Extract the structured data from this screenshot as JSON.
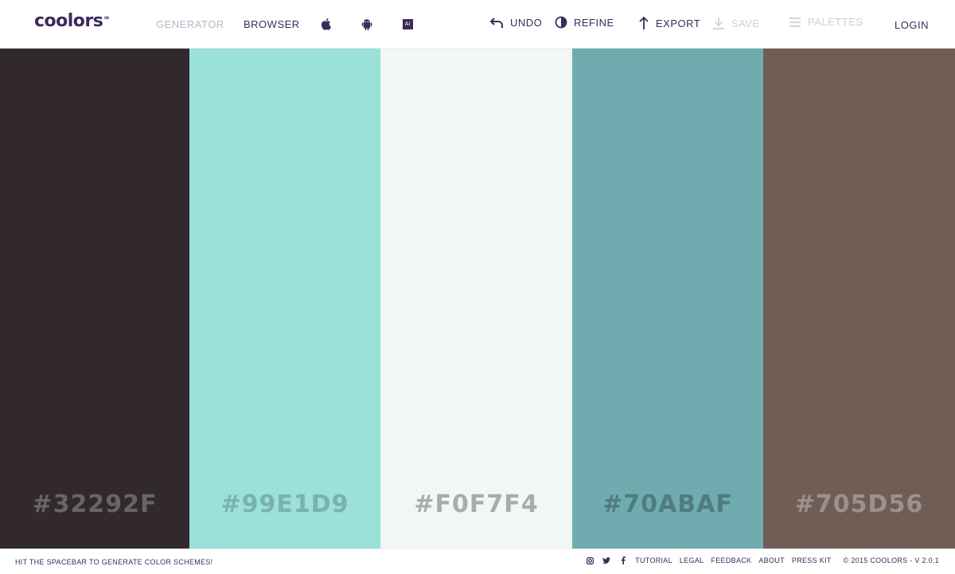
{
  "header": {
    "logo": "coolors",
    "logo_mark": "∞",
    "nav": {
      "generator": "GENERATOR",
      "browser": "BROWSER"
    },
    "platform_icons": [
      "apple-icon",
      "android-icon",
      "adobe-illustrator-icon"
    ],
    "ai_badge": "Ai",
    "actions": {
      "undo": "UNDO",
      "refine": "REFINE",
      "export": "EXPORT",
      "save": "SAVE",
      "palettes": "PALETTES",
      "login": "LOGIN"
    }
  },
  "palette": [
    {
      "hex": "#32292F",
      "color": "#32292F",
      "label_color": "#6a6368"
    },
    {
      "hex": "#99E1D9",
      "color": "#99E1D9",
      "label_color": "#79b3ad"
    },
    {
      "hex": "#F0F7F4",
      "color": "#F0F7F4",
      "label_color": "#a8adaa"
    },
    {
      "hex": "#70ABAF",
      "color": "#70ABAF",
      "label_color": "#4f7c80"
    },
    {
      "hex": "#705D56",
      "color": "#705D56",
      "label_color": "#9e908a"
    }
  ],
  "footer": {
    "hint": "HIT THE SPACEBAR TO GENERATE COLOR SCHEMES!",
    "social_icons": [
      "instagram-icon",
      "twitter-icon",
      "facebook-icon"
    ],
    "links": {
      "tutorial": "TUTORIAL",
      "legal": "LEGAL",
      "feedback": "FEEDBACK",
      "about": "ABOUT",
      "press_kit": "PRESS KIT"
    },
    "copyright": "© 2015 COOLORS - V 2.0.1"
  },
  "colors": {
    "brand": "#3b2a5a",
    "muted": "#bcb5c8",
    "disabled": "#cfcfd6"
  }
}
